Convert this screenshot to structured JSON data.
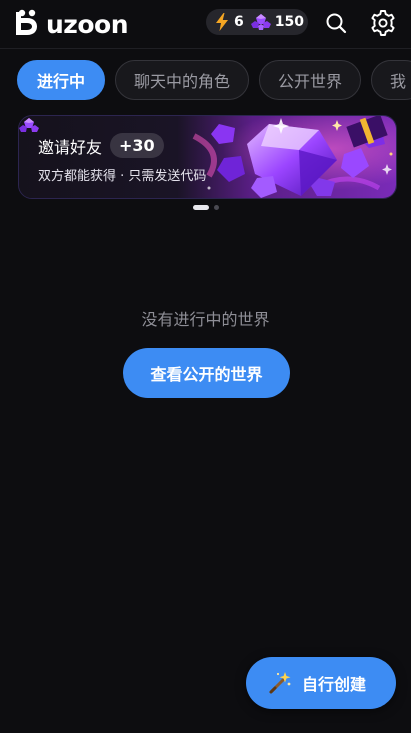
{
  "header": {
    "logo_text": "uzoon",
    "energy_count": "6",
    "gem_count": "150",
    "search_icon": "search-icon",
    "settings_icon": "gear-icon"
  },
  "tabs": [
    {
      "label": "进行中",
      "active": true
    },
    {
      "label": "聊天中的角色",
      "active": false
    },
    {
      "label": "公开世界",
      "active": false
    },
    {
      "label": "我",
      "active": false
    }
  ],
  "banner": {
    "title": "邀请好友",
    "badge": "+30",
    "subtitle": "双方都能获得 · 只需发送代码"
  },
  "carousel": {
    "active_index": 0,
    "count": 2
  },
  "empty_state": {
    "message": "没有进行中的世界",
    "cta_label": "查看公开的世界"
  },
  "fab": {
    "label": "自行创建",
    "icon": "magic-wand-icon"
  },
  "colors": {
    "background": "#0d0d10",
    "accent": "#3d8cf3",
    "tab_bg": "#18181c",
    "muted_text": "#8e8e96"
  }
}
